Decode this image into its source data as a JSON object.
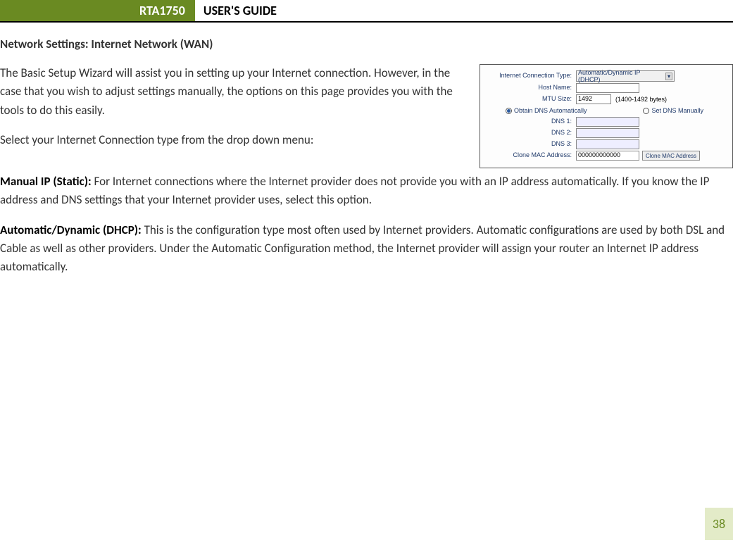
{
  "header": {
    "model": "RTA1750",
    "title": "USER'S GUIDE"
  },
  "section_title": "Network Settings: Internet Network (WAN)",
  "paragraphs": {
    "intro1": "The Basic Setup Wizard will assist you in setting up your Internet connection. However, in the case that you wish to adjust settings manually, the options on this page provides you with the tools to do this easily.",
    "intro2": "Select your Internet Connection type from the drop down menu:",
    "manual_label": "Manual IP (Static): ",
    "manual_text": "For Internet connections where the Internet provider does not provide you with an IP address automatically. If you know the IP address and DNS settings that your Internet provider uses, select this option.",
    "dhcp_label": "Automatic/Dynamic (DHCP): ",
    "dhcp_text": "This is the configuration type most often used by Internet providers. Automatic configurations are used by both DSL and Cable as well as other providers. Under the Automatic Configuration method, the Internet provider will assign your router an Internet IP address automatically."
  },
  "screenshot": {
    "conn_type_label": "Internet Connection Type:",
    "conn_type_value": "Automatic/Dynamic IP (DHCP)",
    "host_label": "Host Name:",
    "host_value": "",
    "mtu_label": "MTU Size:",
    "mtu_value": "1492",
    "mtu_hint": "(1400-1492 bytes)",
    "dns_auto": "Obtain DNS Automatically",
    "dns_manual": "Set DNS Manually",
    "dns1_label": "DNS 1:",
    "dns2_label": "DNS 2:",
    "dns3_label": "DNS 3:",
    "clone_label": "Clone MAC Address:",
    "clone_value": "000000000000",
    "clone_btn": "Clone MAC Address"
  },
  "page_number": "38"
}
